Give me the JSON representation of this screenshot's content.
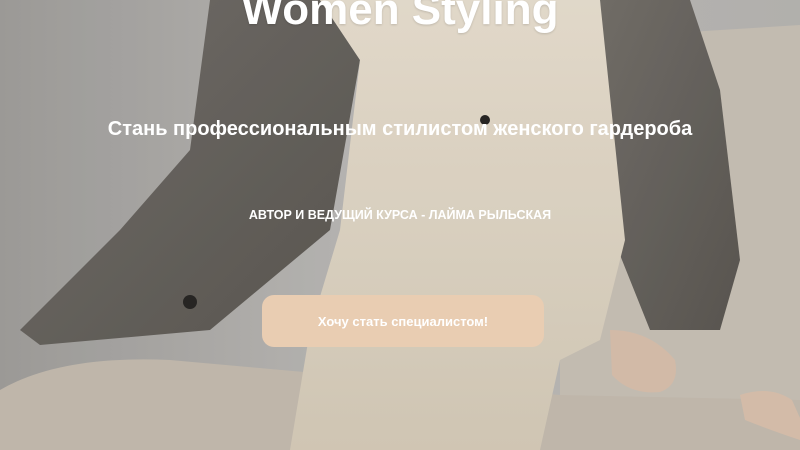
{
  "hero": {
    "title": "Women Styling",
    "subtitle": "Стань профессиональным стилистом женского гардероба",
    "author": "АВТОР И ВЕДУЩИЙ КУРСА - ЛАЙМА РЫЛЬСКАЯ",
    "cta_label": "Хочу стать специалистом!"
  },
  "colors": {
    "cta_background": "#e9cdb2",
    "text": "#ffffff"
  }
}
